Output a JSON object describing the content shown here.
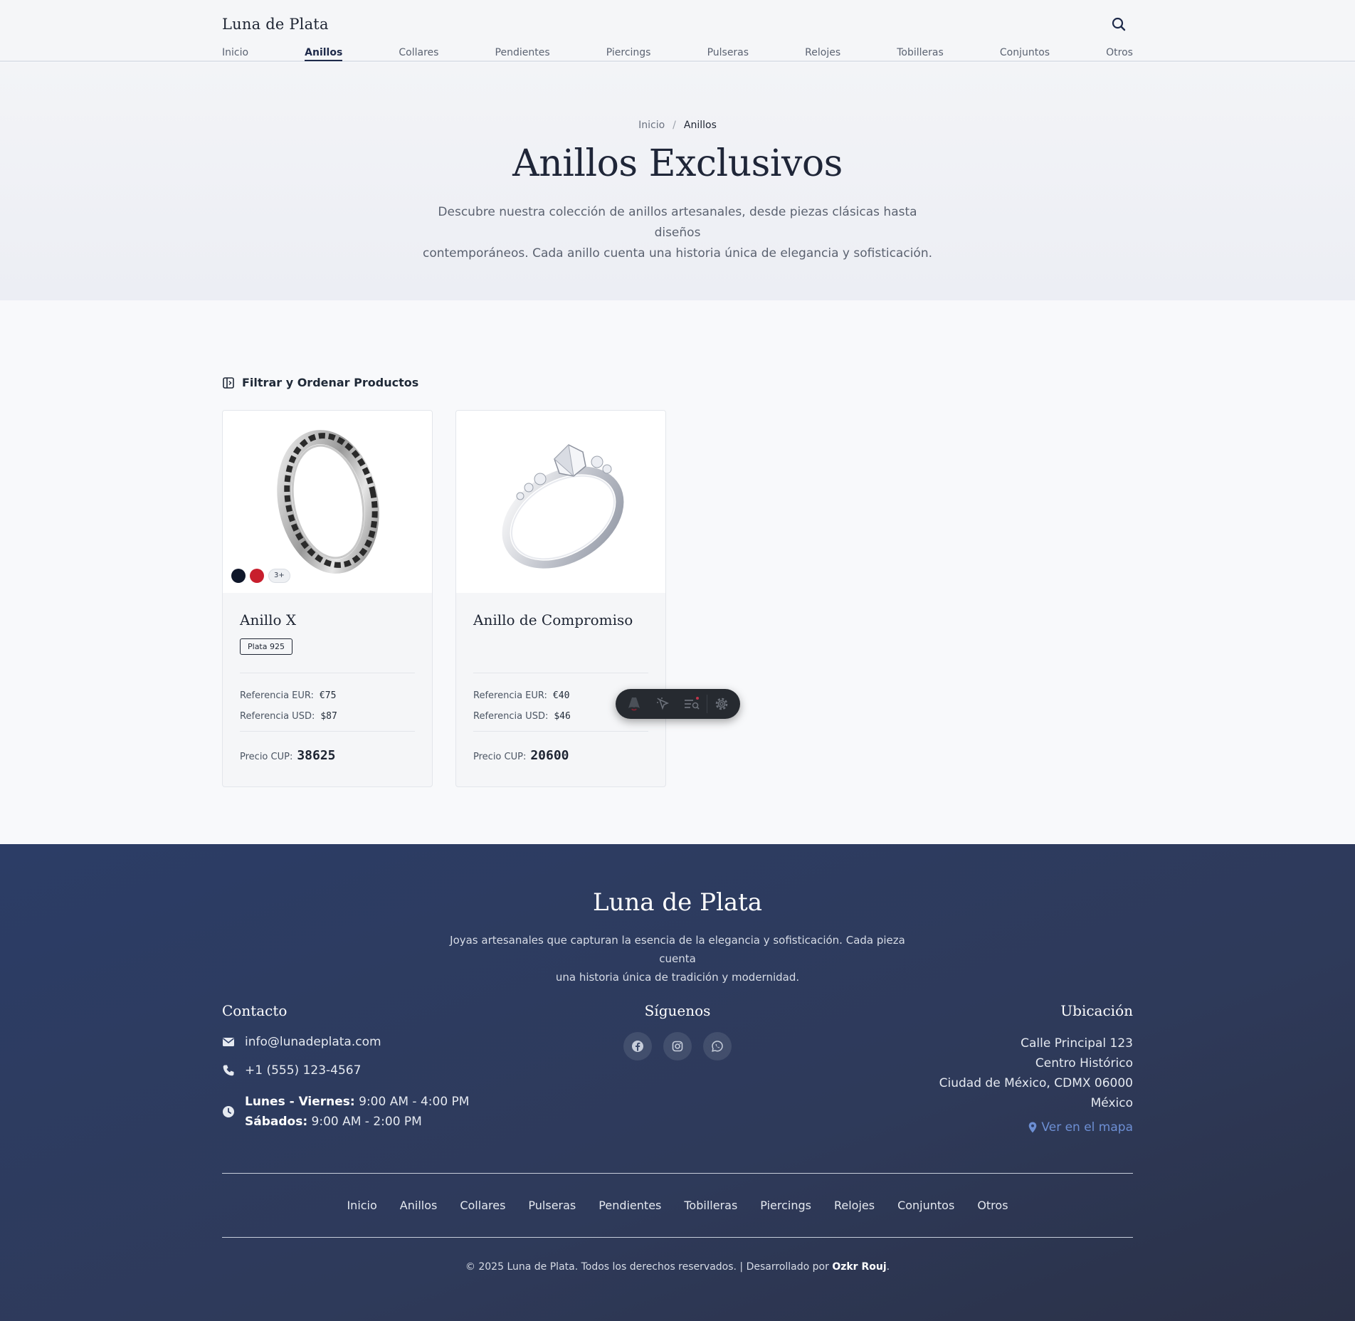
{
  "header": {
    "brand": "Luna de Plata",
    "search_icon": "search-icon",
    "nav": [
      {
        "label": "Inicio"
      },
      {
        "label": "Anillos",
        "active": true
      },
      {
        "label": "Collares"
      },
      {
        "label": "Pendientes"
      },
      {
        "label": "Piercings"
      },
      {
        "label": "Pulseras"
      },
      {
        "label": "Relojes"
      },
      {
        "label": "Tobilleras"
      },
      {
        "label": "Conjuntos"
      },
      {
        "label": "Otros"
      }
    ]
  },
  "hero": {
    "breadcrumb": {
      "home": "Inicio",
      "separator": "/",
      "current": "Anillos"
    },
    "title": "Anillos Exclusivos",
    "description_line1": "Descubre nuestra colección de anillos artesanales, desde piezas clásicas hasta diseños",
    "description_line2": "contemporáneos. Cada anillo cuenta una historia única de elegancia y sofisticación."
  },
  "filter": {
    "label": "Filtrar y Ordenar Productos",
    "icon": "sidebar-panel-icon"
  },
  "products": [
    {
      "name": "Anillo X",
      "badge": "Plata 925",
      "colors": [
        "#0f172a",
        "#c81e2d"
      ],
      "more_colors": "3+",
      "ref_eur_label": "Referencia EUR:",
      "ref_eur": "€75",
      "ref_usd_label": "Referencia USD:",
      "ref_usd": "$87",
      "price_label": "Precio CUP:",
      "price": "38625"
    },
    {
      "name": "Anillo de Compromiso",
      "ref_eur_label": "Referencia EUR:",
      "ref_eur": "€40",
      "ref_usd_label": "Referencia USD:",
      "ref_usd": "$46",
      "price_label": "Precio CUP:",
      "price": "20600"
    }
  ],
  "floating_toolbar": {
    "icons": [
      "astro-logo-icon",
      "cursor-inspect-icon",
      "audit-list-icon",
      "settings-gear-icon"
    ]
  },
  "footer": {
    "brand": "Luna de Plata",
    "description_line1": "Joyas artesanales que capturan la esencia de la elegancia y sofisticación. Cada pieza cuenta",
    "description_line2": "una historia única de tradición y modernidad.",
    "contact": {
      "heading": "Contacto",
      "email": "info@lunadeplata.com",
      "phone": "+1 (555) 123-4567",
      "weekdays_label": "Lunes - Viernes:",
      "weekdays_hours": "9:00 AM - 4:00 PM",
      "saturday_label": "Sábados:",
      "saturday_hours": "9:00 AM - 2:00 PM"
    },
    "social": {
      "heading": "Síguenos",
      "icons": [
        "facebook-icon",
        "instagram-icon",
        "whatsapp-icon"
      ]
    },
    "location": {
      "heading": "Ubicación",
      "line1": "Calle Principal 123",
      "line2": "Centro Histórico",
      "line3": "Ciudad de México, CDMX 06000",
      "line4": "México",
      "map_link": "Ver en el mapa"
    },
    "nav": [
      "Inicio",
      "Anillos",
      "Collares",
      "Pulseras",
      "Pendientes",
      "Tobilleras",
      "Piercings",
      "Relojes",
      "Conjuntos",
      "Otros"
    ],
    "copyright_prefix": "© 2025 Luna de Plata. Todos los derechos reservados. | Desarrollado por",
    "developer": "Ozkr Rouj",
    "copyright_suffix": "."
  },
  "colors": {
    "accent": "#1e2a4a",
    "footer_bg": "#2c3d66",
    "map_link": "#6d8fd4"
  }
}
